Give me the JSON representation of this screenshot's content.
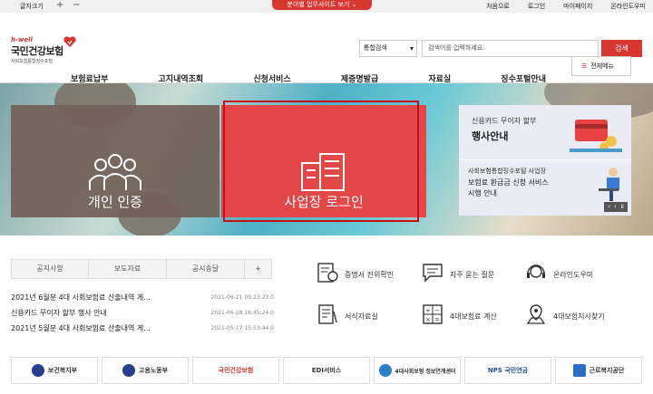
{
  "util": {
    "font_size": "글자크기",
    "plus": "+",
    "minus": "−",
    "menu": "분야별 업무사이트 보기",
    "links": [
      "처음으로",
      "로그인",
      "마이페이지",
      "온라인도우미"
    ]
  },
  "logo": {
    "hwell": "h-well",
    "name": "국민건강보험",
    "sub": "사회보험통합징수포털"
  },
  "search": {
    "select": "통합검색",
    "placeholder": "검색어를 입력하세요.",
    "button": "검색"
  },
  "nav": [
    "보험료납부",
    "고지내역조회",
    "신청서비스",
    "제증명발급",
    "자료실",
    "징수포털안내"
  ],
  "allmenu": "전체메뉴",
  "hero": {
    "personal": "개인 인증",
    "biz": "사업장 로그인"
  },
  "banner": {
    "l1": "신용카드 무이자 할부",
    "l2": "행사안내",
    "l3": "사회보험통합징수포털 사업장",
    "l4": "보험료 환급금 신청 서비스",
    "l5": "시행 안내",
    "prev": "‹",
    "next": "›",
    "pause": "॥"
  },
  "tabs": [
    "공지사항",
    "보도자료",
    "공시송달",
    "+"
  ],
  "news": [
    {
      "title": "2021년 6월분 4대 사회보험료 산출내역 게...",
      "date": "2021-06-21 09:23:23.0"
    },
    {
      "title": "신용카드 무이자 할부 행사 안내",
      "date": "2021-06-28 18:45:24.0"
    },
    {
      "title": "2021년 5월분 4대 사회보험료 산출내역 게...",
      "date": "2021-05-17 15:53:44.0"
    }
  ],
  "quick": [
    "증명서 진위확인",
    "자주 묻는 질문",
    "온라인도우미",
    "서식자료실",
    "4대보험료 계산",
    "4대보험지사찾기"
  ],
  "logos": [
    "보건복지부",
    "고용노동부",
    "국민건강보험",
    "EDI서비스",
    "4대사회보험 정보연계센터",
    "NPS 국민연금",
    "근로복지공단"
  ],
  "colors": {
    "accent": "#d6372f",
    "personal": "#73625a",
    "biz": "#e84242"
  }
}
